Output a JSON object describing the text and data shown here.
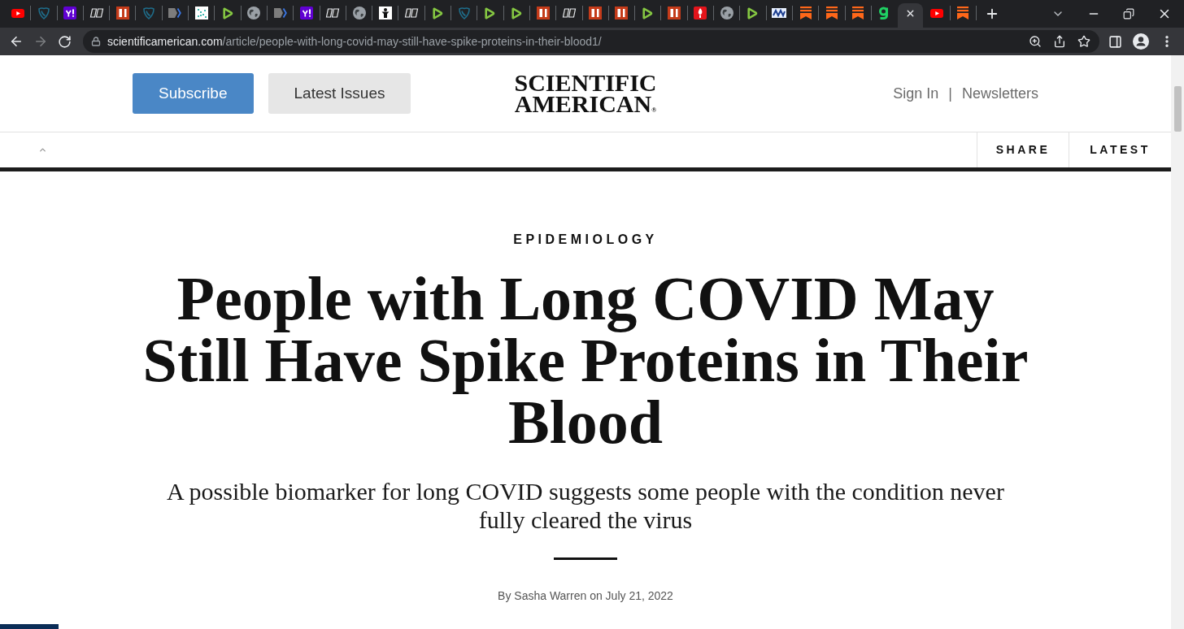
{
  "browser": {
    "tabs": [
      {
        "kind": "video",
        "selected": false
      },
      {
        "kind": "shield",
        "selected": false
      },
      {
        "kind": "exclaim",
        "selected": false
      },
      {
        "kind": "slant",
        "selected": false
      },
      {
        "kind": "bars",
        "selected": false
      },
      {
        "kind": "shield",
        "selected": false
      },
      {
        "kind": "tag",
        "selected": false
      },
      {
        "kind": "dots",
        "selected": false
      },
      {
        "kind": "play",
        "selected": false
      },
      {
        "kind": "globe",
        "selected": false
      },
      {
        "kind": "tag",
        "selected": false
      },
      {
        "kind": "exclaim",
        "selected": false
      },
      {
        "kind": "slant",
        "selected": false
      },
      {
        "kind": "globe",
        "selected": false
      },
      {
        "kind": "figure",
        "selected": false
      },
      {
        "kind": "slant",
        "selected": false
      },
      {
        "kind": "play",
        "selected": false
      },
      {
        "kind": "shield",
        "selected": false
      },
      {
        "kind": "play",
        "selected": false
      },
      {
        "kind": "play",
        "selected": false
      },
      {
        "kind": "bars",
        "selected": false
      },
      {
        "kind": "slant",
        "selected": false
      },
      {
        "kind": "bars",
        "selected": false
      },
      {
        "kind": "bars",
        "selected": false
      },
      {
        "kind": "play",
        "selected": false
      },
      {
        "kind": "bars",
        "selected": false
      },
      {
        "kind": "flame",
        "selected": false
      },
      {
        "kind": "globe",
        "selected": false
      },
      {
        "kind": "play",
        "selected": false
      },
      {
        "kind": "zigzag",
        "selected": false
      },
      {
        "kind": "bookmark",
        "selected": false
      },
      {
        "kind": "bookmark",
        "selected": false
      },
      {
        "kind": "bookmark",
        "selected": false
      },
      {
        "kind": "hook",
        "selected": false
      },
      {
        "selected": true
      },
      {
        "kind": "video",
        "selected": false
      },
      {
        "kind": "bookmark",
        "selected": false
      }
    ],
    "nav": [
      {
        "kind": "back",
        "disabled": false
      },
      {
        "kind": "forward",
        "disabled": true
      },
      {
        "kind": "reload",
        "disabled": false
      }
    ],
    "address_bar": {
      "domain": "scientificamerican.com",
      "path": "/article/people-with-long-covid-may-still-have-spike-proteins-in-their-blood1/"
    }
  },
  "header": {
    "buttons": [
      {
        "label": "Subscribe",
        "kind": "primary"
      },
      {
        "label": "Latest Issues",
        "kind": "secondary"
      }
    ],
    "logo": "SCIENTIFIC AMERICAN$_{®}$",
    "links": [
      "Sign In",
      "Newsletters"
    ],
    "separator": "|"
  },
  "nav_bar": {
    "items": [
      "SHARE",
      "LATEST"
    ]
  },
  "article": {
    "section": "EPIDEMIOLOGY",
    "title": "People with Long COVID May Still Have Spike Proteins in Their Blood",
    "subtitle": "A possible biomarker for long COVID suggests some people with the condition never fully cleared the virus",
    "byline": "By Sasha Warren on July 21, 2022"
  }
}
